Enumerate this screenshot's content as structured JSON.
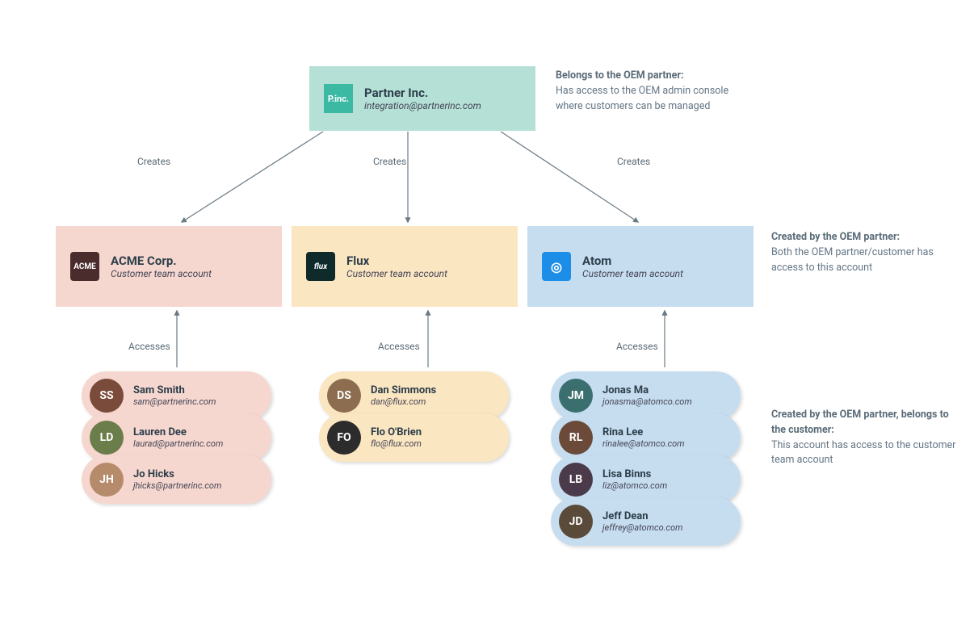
{
  "partner": {
    "name": "Partner Inc.",
    "email": "integration@partnerinc.com",
    "logo_text": "P.inc."
  },
  "annotations": {
    "partner_title": "Belongs to the OEM partner:",
    "partner_body": "Has access to the OEM admin console where customers can be managed",
    "customer_title": "Created by the OEM partner:",
    "customer_body": "Both the OEM partner/customer has access to this account",
    "user_title": "Created by the OEM partner, belongs to the customer:",
    "user_body": "This account has access to the customer team account"
  },
  "edges": {
    "creates": "Creates",
    "accesses": "Accesses"
  },
  "customers": {
    "acme": {
      "name": "ACME Corp.",
      "subtitle": "Customer team account",
      "logo_text": "ACME"
    },
    "flux": {
      "name": "Flux",
      "subtitle": "Customer team account",
      "logo_text": "flux"
    },
    "atom": {
      "name": "Atom",
      "subtitle": "Customer team account",
      "logo_text": "◎"
    }
  },
  "users": {
    "acme": [
      {
        "name": "Sam Smith",
        "email": "sam@partnerinc.com",
        "initials": "SS",
        "avatar_bg": "#7a4b3a"
      },
      {
        "name": "Lauren Dee",
        "email": "laurad@partnerinc.com",
        "initials": "LD",
        "avatar_bg": "#6b7d4a"
      },
      {
        "name": "Jo Hicks",
        "email": "jhicks@partnerinc.com",
        "initials": "JH",
        "avatar_bg": "#b58b6b"
      }
    ],
    "flux": [
      {
        "name": "Dan Simmons",
        "email": "dan@flux.com",
        "initials": "DS",
        "avatar_bg": "#8c6d4f"
      },
      {
        "name": "Flo O'Brien",
        "email": "flo@flux.com",
        "initials": "FO",
        "avatar_bg": "#2c2c2c"
      }
    ],
    "atom": [
      {
        "name": "Jonas Ma",
        "email": "jonasma@atomco.com",
        "initials": "JM",
        "avatar_bg": "#3b6f6f"
      },
      {
        "name": "Rina Lee",
        "email": "rinalee@atomco.com",
        "initials": "RL",
        "avatar_bg": "#6b4a3a"
      },
      {
        "name": "Lisa Binns",
        "email": "liz@atomco.com",
        "initials": "LB",
        "avatar_bg": "#4a3a4a"
      },
      {
        "name": "Jeff Dean",
        "email": "jeffrey@atomco.com",
        "initials": "JD",
        "avatar_bg": "#5a4a3a"
      }
    ]
  }
}
